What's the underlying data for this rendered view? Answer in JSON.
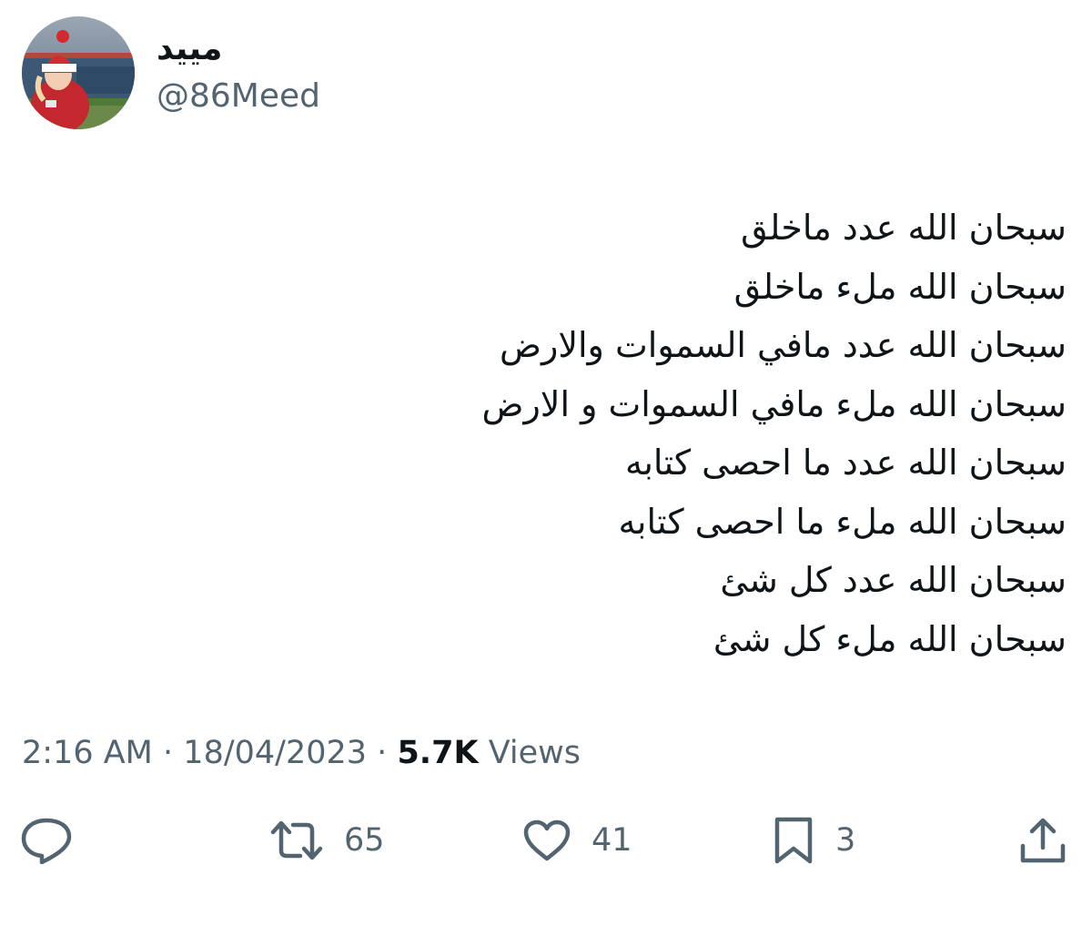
{
  "author": {
    "display_name": "مييد",
    "handle": "@86Meed",
    "avatar_icon": "profile-photo"
  },
  "tweet": {
    "lines": [
      "سبحان الله عدد ماخلق",
      "سبحان الله ملء ماخلق",
      "سبحان الله عدد مافي السموات والارض",
      "سبحان الله ملء مافي السموات و الارض",
      "سبحان الله عدد ما احصى كتابه",
      "سبحان الله ملء ما احصى كتابه",
      "سبحان الله عدد كل شئ",
      "سبحان الله ملء كل شئ"
    ]
  },
  "meta": {
    "time": "2:16 AM",
    "separator": "·",
    "date": "18/04/2023",
    "views_count": "5.7K",
    "views_label": "Views"
  },
  "actions": {
    "reply": {
      "icon": "reply-icon",
      "count": ""
    },
    "retweet": {
      "icon": "retweet-icon",
      "count": "65"
    },
    "like": {
      "icon": "heart-icon",
      "count": "41"
    },
    "bookmark": {
      "icon": "bookmark-icon",
      "count": "3"
    },
    "share": {
      "icon": "share-icon",
      "count": ""
    }
  },
  "colors": {
    "text_primary": "#0f1419",
    "text_secondary": "#536471",
    "background": "#ffffff"
  }
}
